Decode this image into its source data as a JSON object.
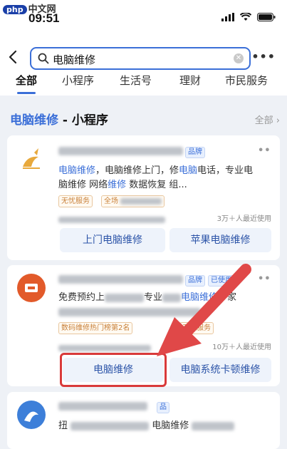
{
  "status": {
    "watermark_brand": "php",
    "watermark_text": "中文网",
    "time": "09:51"
  },
  "search": {
    "query": "电脑维修"
  },
  "tabs": [
    "全部",
    "小程序",
    "生活号",
    "理财",
    "市民服务"
  ],
  "section": {
    "keyword": "电脑维修",
    "suffix": " - 小程序",
    "all_label": "全部"
  },
  "cards": [
    {
      "tag": "品牌",
      "desc_k1": "电脑维修",
      "desc_t1": "，电脑维修上门，修",
      "desc_k2": "电脑",
      "desc_t2": "电话，专业电",
      "desc_line2_a": "脑维修 网络",
      "desc_k3": "维修",
      "desc_line2_b": " 数据恢复 组...",
      "service1": "无忧服务",
      "service2_prefix": "全场",
      "usage": "3万＋人最近使用",
      "btn1": "上门电脑维修",
      "btn2": "苹果电脑维修"
    },
    {
      "tag1": "品牌",
      "tag2": "已使用",
      "desc_line1_a": "免费预约上",
      "desc_line1_b": "专业",
      "desc_k1": "电脑维修",
      "desc_line1_c": "，家",
      "service1": "数码维修热门榜第2名",
      "service2": "无忧服务",
      "usage": "10万＋人最近使用",
      "btn1": "电脑维修",
      "btn2": "电脑系统卡顿维修"
    },
    {
      "tag": "品",
      "desc_line1_a": "扭",
      "desc_line1_b": "电脑维修"
    }
  ]
}
